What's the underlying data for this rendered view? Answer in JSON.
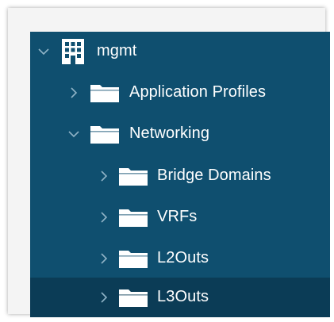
{
  "tree": {
    "root": {
      "label": "mgmt",
      "icon": "building-icon",
      "expanded": true
    },
    "items": [
      {
        "label": "Application Profiles",
        "icon": "folder-icon",
        "expanded": false,
        "selected": false
      },
      {
        "label": "Networking",
        "icon": "folder-icon",
        "expanded": true,
        "selected": false
      },
      {
        "label": "Bridge Domains",
        "icon": "folder-icon",
        "expanded": false,
        "selected": false
      },
      {
        "label": "VRFs",
        "icon": "folder-icon",
        "expanded": false,
        "selected": false
      },
      {
        "label": "L2Outs",
        "icon": "folder-icon",
        "expanded": false,
        "selected": false
      },
      {
        "label": "L3Outs",
        "icon": "folder-icon",
        "expanded": false,
        "selected": true
      }
    ]
  },
  "colors": {
    "tree_background": "#0f4f6f",
    "selected_row": "#0b3c56",
    "text": "#ffffff",
    "chevron": "#8fb3c6"
  }
}
